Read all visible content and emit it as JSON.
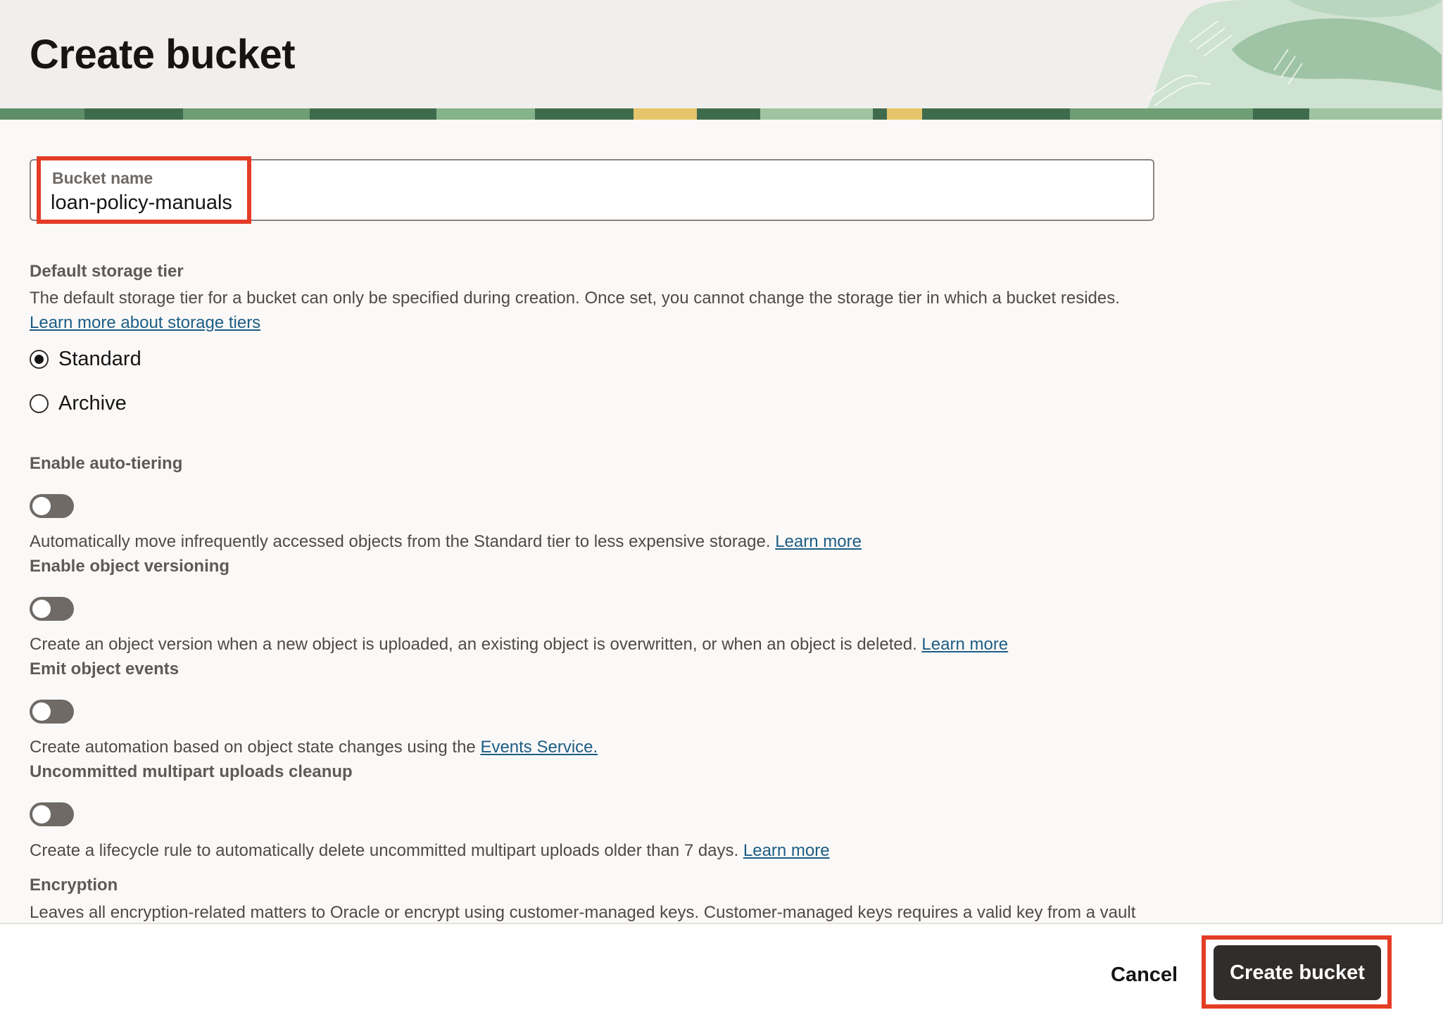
{
  "header": {
    "title": "Create bucket"
  },
  "bucket_name": {
    "label": "Bucket name",
    "value": "loan-policy-manuals"
  },
  "storage_tier": {
    "label": "Default storage tier",
    "description": "The default storage tier for a bucket can only be specified during creation. Once set, you cannot change the storage tier in which a bucket resides.",
    "link": "Learn more about storage tiers",
    "options": [
      {
        "label": "Standard",
        "selected": true
      },
      {
        "label": "Archive",
        "selected": false
      }
    ]
  },
  "auto_tiering": {
    "label": "Enable auto-tiering",
    "enabled": false,
    "description": "Automatically move infrequently accessed objects from the Standard tier to less expensive storage.",
    "link": "Learn more"
  },
  "versioning": {
    "label": "Enable object versioning",
    "enabled": false,
    "description": "Create an object version when a new object is uploaded, an existing object is overwritten, or when an object is deleted.",
    "link": "Learn more"
  },
  "events": {
    "label": "Emit object events",
    "enabled": false,
    "description": "Create automation based on object state changes using the",
    "link": "Events Service."
  },
  "multipart_cleanup": {
    "label": "Uncommitted multipart uploads cleanup",
    "enabled": false,
    "description": "Create a lifecycle rule to automatically delete uncommitted multipart uploads older than 7 days.",
    "link": "Learn more"
  },
  "encryption": {
    "label": "Encryption",
    "description": "Leaves all encryption-related matters to Oracle or encrypt using customer-managed keys. Customer-managed keys requires a valid key from a vault"
  },
  "footer": {
    "cancel_label": "Cancel",
    "create_label": "Create bucket"
  },
  "colors": {
    "primary_button": "#312d2a",
    "link": "#1c5d84",
    "highlight": "#e43d25",
    "toggle_off": "#6f6a65"
  }
}
